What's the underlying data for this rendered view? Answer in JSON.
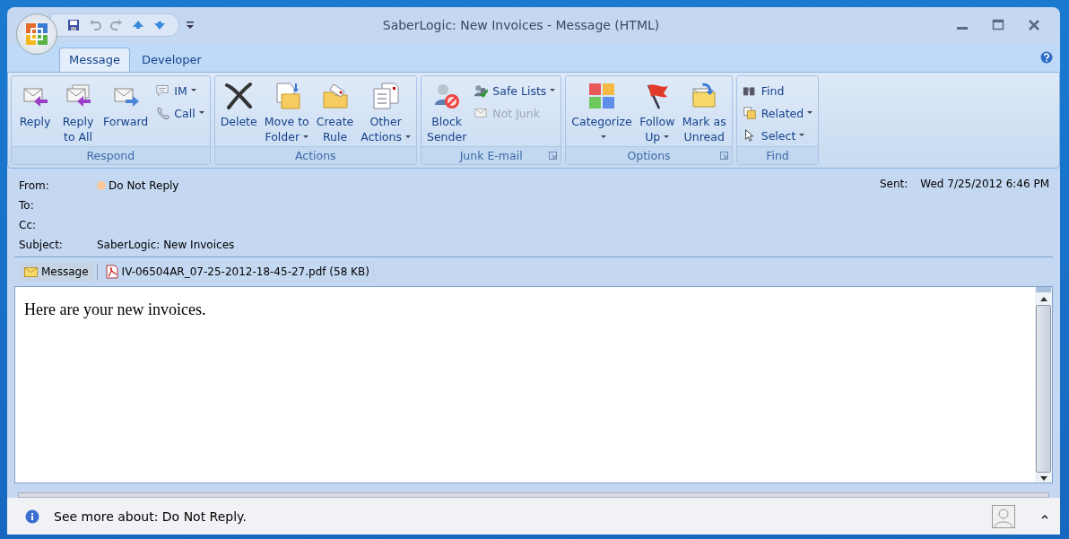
{
  "window": {
    "title": "SaberLogic: New Invoices - Message (HTML)"
  },
  "tabs": [
    {
      "label": "Message",
      "selected": true
    },
    {
      "label": "Developer",
      "selected": false
    }
  ],
  "ribbon": {
    "groups": [
      {
        "label": "Respond",
        "launcher": false,
        "buttons": [
          {
            "kind": "large",
            "lines": [
              "Reply"
            ],
            "dropdown": false,
            "disabled": false
          },
          {
            "kind": "large",
            "lines": [
              "Reply",
              "to All"
            ],
            "dropdown": false,
            "disabled": false
          },
          {
            "kind": "large",
            "lines": [
              "Forward"
            ],
            "dropdown": false,
            "disabled": false
          },
          {
            "kind": "small",
            "lines": [
              "IM"
            ],
            "dropdown": true,
            "disabled": false
          },
          {
            "kind": "small",
            "lines": [
              "Call"
            ],
            "dropdown": true,
            "disabled": false
          }
        ]
      },
      {
        "label": "Actions",
        "launcher": false,
        "buttons": [
          {
            "kind": "large",
            "lines": [
              "Delete"
            ],
            "dropdown": false,
            "disabled": false
          },
          {
            "kind": "large",
            "lines": [
              "Move to",
              "Folder"
            ],
            "dropdown": true,
            "disabled": false
          },
          {
            "kind": "large",
            "lines": [
              "Create",
              "Rule"
            ],
            "dropdown": false,
            "disabled": false
          },
          {
            "kind": "large",
            "lines": [
              "Other",
              "Actions"
            ],
            "dropdown": true,
            "disabled": false
          }
        ]
      },
      {
        "label": "Junk E-mail",
        "launcher": true,
        "buttons": [
          {
            "kind": "large",
            "lines": [
              "Block",
              "Sender"
            ],
            "dropdown": false,
            "disabled": false
          },
          {
            "kind": "small",
            "lines": [
              "Safe Lists"
            ],
            "dropdown": true,
            "disabled": false
          },
          {
            "kind": "small",
            "lines": [
              "Not Junk"
            ],
            "dropdown": false,
            "disabled": true
          }
        ]
      },
      {
        "label": "Options",
        "launcher": true,
        "buttons": [
          {
            "kind": "large",
            "lines": [
              "Categorize"
            ],
            "dropdown": true,
            "disabled": false
          },
          {
            "kind": "large",
            "lines": [
              "Follow",
              "Up"
            ],
            "dropdown": true,
            "disabled": false
          },
          {
            "kind": "large",
            "lines": [
              "Mark as",
              "Unread"
            ],
            "dropdown": false,
            "disabled": false
          }
        ]
      },
      {
        "label": "Find",
        "launcher": false,
        "buttons": [
          {
            "kind": "small",
            "lines": [
              "Find"
            ],
            "dropdown": false,
            "disabled": false
          },
          {
            "kind": "small",
            "lines": [
              "Related"
            ],
            "dropdown": true,
            "disabled": false
          },
          {
            "kind": "small",
            "lines": [
              "Select"
            ],
            "dropdown": true,
            "disabled": false
          }
        ]
      }
    ]
  },
  "header": {
    "fields": [
      {
        "label": "From:",
        "value": "Do Not Reply",
        "kind": "contact"
      },
      {
        "label": "To:"
      },
      {
        "label": "Cc:"
      },
      {
        "label": "Subject:",
        "value": "SaberLogic: New Invoices"
      }
    ],
    "sent": {
      "label": "Sent:",
      "value": "Wed 7/25/2012 6:46 PM"
    }
  },
  "attachments": [
    {
      "label": "Message",
      "kind": "message",
      "selected": true
    },
    {
      "label": "IV-06504AR_07-25-2012-18-45-27.pdf (58 KB)",
      "kind": "pdf",
      "selected": false
    }
  ],
  "body": {
    "text": "Here are your new invoices."
  },
  "people_pane": {
    "text": "See more about: Do Not Reply."
  }
}
